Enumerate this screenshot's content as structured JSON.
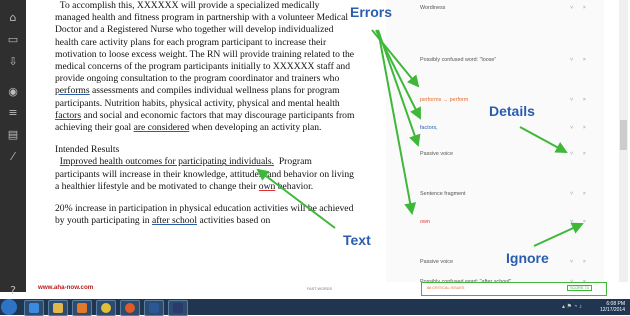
{
  "sidebar": {
    "icons": [
      "home-icon",
      "document-icon",
      "download-icon",
      "blank-icon",
      "tag-icon",
      "filter-icon",
      "chat-icon",
      "flag-icon",
      "tool-icon",
      "help-icon"
    ]
  },
  "document": {
    "p1_a": "To accomplish this, XXXXXX will provide a specialized medically managed health and fitness program in partnership with a volunteer Medical Doctor and a Registered Nurse who together will develop individualized health care activity plans for each program participant to increase their motivation to loose excess weight.",
    "p1_b": "The RN will provide training related to the medical concerns of the program participants initially to XXXXXX staff and provide ongoing consultation to the program coordinator and trainers who",
    "p1_performs": "performs",
    "p1_c": "assessments and compiles individual wellness plans for program participants.  Nutrition habits, physical activity, physical and mental health",
    "p1_factors": "factors",
    "p1_d": "and social and economic factors that may discourage participants from achieving their goal",
    "p1_considered": "are considered",
    "p1_e": "when developing an activity plan.",
    "heading": "Intended Results",
    "p2_a": "Improved health outcomes for participating individuals.",
    "p2_b": "Program participants will increase in their knowledge, attitudes, and behavior on living a healthier lifestyle and be motivated to change their",
    "p2_own": "own",
    "p2_c": "behavior.",
    "p3_a": "20% increase in participation in physical education activities will be achieved by youth participating in",
    "p3_after": "after school",
    "p3_b": "activities based on"
  },
  "panel": {
    "cards": [
      {
        "title": "Wordiness",
        "class": ""
      },
      {
        "title": "Possibly confused word: \"loose\"",
        "class": ""
      },
      {
        "title": "performs → perform",
        "class": "orange"
      },
      {
        "title": "factors,",
        "class": "blue"
      },
      {
        "title": "Passive voice",
        "class": ""
      },
      {
        "title": "Sentence fragment",
        "class": ""
      },
      {
        "title": "own",
        "class": "red"
      },
      {
        "title": "Passive voice",
        "class": ""
      },
      {
        "title": "Possibly confused word: \"after school\"",
        "class": ""
      }
    ],
    "controls": "˅ ×"
  },
  "annotations": {
    "errors": "Errors",
    "details": "Details",
    "text": "Text",
    "ignore": "Ignore"
  },
  "footer": {
    "site": "www.aha-now.com",
    "status": "FAST WORDS",
    "critical": "88 CRITICAL ISSUES",
    "score": "SCORE 73"
  },
  "taskbar": {
    "time": "6:08 PM",
    "date": "12/17/2014",
    "apps": [
      {
        "name": "ie-icon",
        "color": "#3a8be0"
      },
      {
        "name": "folder-icon",
        "color": "#e2b84a"
      },
      {
        "name": "media-icon",
        "color": "#e07a2a"
      },
      {
        "name": "chrome-icon",
        "color": "#e0c03a"
      },
      {
        "name": "firefox-icon",
        "color": "#e05a2a"
      },
      {
        "name": "word-icon",
        "color": "#2b5797"
      },
      {
        "name": "photoshop-icon",
        "color": "#2a3a6a"
      }
    ]
  },
  "colors": {
    "accent": "#2a5db0",
    "sidebar": "#2f2f2f",
    "issue_box": "#3fb83a"
  }
}
